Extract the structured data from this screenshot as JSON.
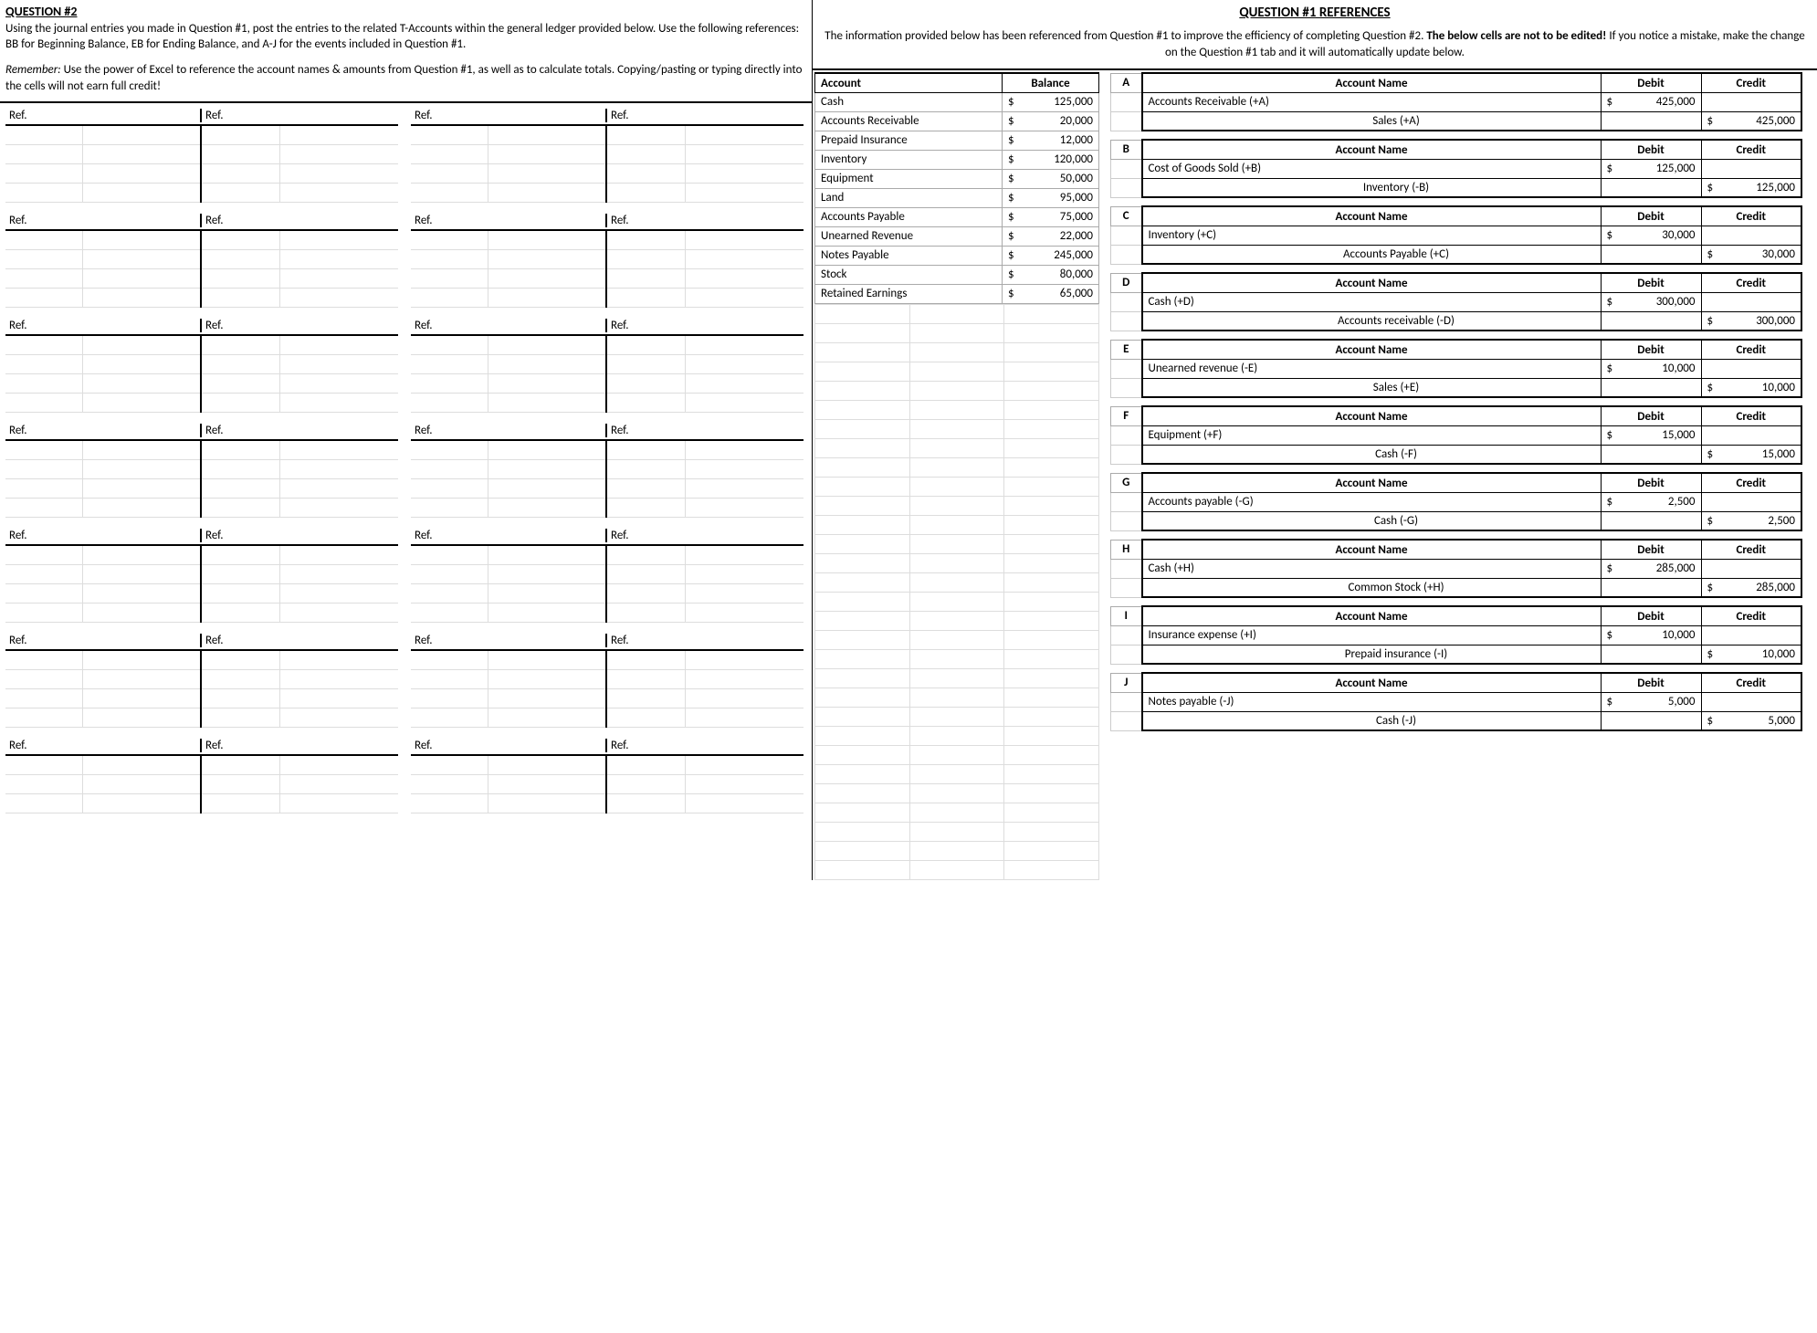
{
  "left": {
    "title": "QUESTION #2",
    "para1": "Using the journal entries you made in Question #1, post the entries to the related T-Accounts within the general ledger provided below. Use the following references: BB for Beginning Balance, EB for Ending Balance, and A-J for the events included in Question #1.",
    "remember_label": "Remember:",
    "remember_text": " Use the power of Excel to reference the account names & amounts from Question #1, as well as to calculate totals. Copying/pasting or typing directly into the cells will not earn full credit!",
    "ref_label": "Ref."
  },
  "right": {
    "title": "QUESTION #1 REFERENCES",
    "para_pre": "The information provided below has been referenced from Question #1 to improve the efficiency of completing Question #2. ",
    "para_bold": "The below cells are not to be edited!",
    "para_post": " If you notice a mistake, make the change on the Question #1 tab and it will automatically update below."
  },
  "balances": {
    "head_account": "Account",
    "head_balance": "Balance",
    "rows": [
      {
        "account": "Cash",
        "balance": "$ 125,000"
      },
      {
        "account": "Accounts Receivable",
        "balance": "$  20,000"
      },
      {
        "account": "Prepaid Insurance",
        "balance": "$  12,000"
      },
      {
        "account": "Inventory",
        "balance": "$ 120,000"
      },
      {
        "account": "Equipment",
        "balance": "$  50,000"
      },
      {
        "account": "Land",
        "balance": "$  95,000"
      },
      {
        "account": "Accounts Payable",
        "balance": "$  75,000"
      },
      {
        "account": "Unearned Revenue",
        "balance": "$  22,000"
      },
      {
        "account": "Notes Payable",
        "balance": "$ 245,000"
      },
      {
        "account": "Stock",
        "balance": "$  80,000"
      },
      {
        "account": "Retained Earnings",
        "balance": "$  65,000"
      }
    ]
  },
  "entries_head": {
    "account_name": "Account Name",
    "debit": "Debit",
    "credit": "Credit"
  },
  "entries": [
    {
      "letter": "A",
      "debit_acc": "Accounts Receivable (+A)",
      "debit_amt": "$ 425,000",
      "credit_acc": "Sales (+A)",
      "credit_amt": "$ 425,000"
    },
    {
      "letter": "B",
      "debit_acc": "Cost of Goods Sold (+B)",
      "debit_amt": "$ 125,000",
      "credit_acc": "Inventory (-B)",
      "credit_amt": "$ 125,000"
    },
    {
      "letter": "C",
      "debit_acc": "Inventory (+C)",
      "debit_amt": "$  30,000",
      "credit_acc": "Accounts Payable (+C)",
      "credit_amt": "$  30,000"
    },
    {
      "letter": "D",
      "debit_acc": "Cash (+D)",
      "debit_amt": "$ 300,000",
      "credit_acc": "Accounts receivable (-D)",
      "credit_amt": "$ 300,000"
    },
    {
      "letter": "E",
      "debit_acc": "Unearned revenue (-E)",
      "debit_amt": "$  10,000",
      "credit_acc": "Sales (+E)",
      "credit_amt": "$  10,000"
    },
    {
      "letter": "F",
      "debit_acc": "Equipment (+F)",
      "debit_amt": "$  15,000",
      "credit_acc": "Cash (-F)",
      "credit_amt": "$  15,000"
    },
    {
      "letter": "G",
      "debit_acc": "Accounts payable (-G)",
      "debit_amt": "$    2,500",
      "credit_acc": "Cash (-G)",
      "credit_amt": "$    2,500"
    },
    {
      "letter": "H",
      "debit_acc": "Cash (+H)",
      "debit_amt": "$ 285,000",
      "credit_acc": "Common Stock (+H)",
      "credit_amt": "$ 285,000"
    },
    {
      "letter": "I",
      "debit_acc": "Insurance expense (+I)",
      "debit_amt": "$  10,000",
      "credit_acc": "Prepaid insurance (-I)",
      "credit_amt": "$  10,000"
    },
    {
      "letter": "J",
      "debit_acc": "Notes payable (-J)",
      "debit_amt": "$    5,000",
      "credit_acc": "Cash (-J)",
      "credit_amt": "$    5,000"
    }
  ]
}
